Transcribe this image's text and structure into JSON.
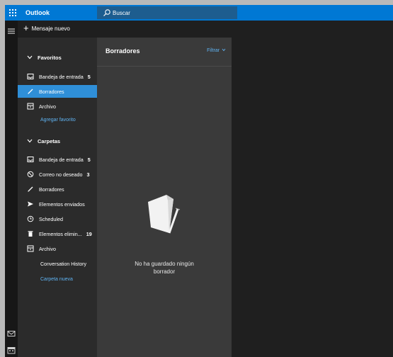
{
  "topbar": {
    "app_title": "Outlook",
    "search_placeholder": "Buscar",
    "accent_color": "#0078d4"
  },
  "toolbar": {
    "new_message_label": "Mensaje nuevo"
  },
  "favorites": {
    "header": "Favoritos",
    "items": [
      {
        "label": "Bandeja de entrada",
        "count": "5",
        "icon": "inbox-icon",
        "selected": false
      },
      {
        "label": "Borradores",
        "count": "",
        "icon": "pencil-icon",
        "selected": true
      },
      {
        "label": "Archivo",
        "count": "",
        "icon": "archive-icon",
        "selected": false
      }
    ],
    "add_favorite_label": "Agregar favorito"
  },
  "folders": {
    "header": "Carpetas",
    "items": [
      {
        "label": "Bandeja de entrada",
        "count": "5",
        "icon": "inbox-icon"
      },
      {
        "label": "Correo no deseado",
        "count": "3",
        "icon": "blocked-icon"
      },
      {
        "label": "Borradores",
        "count": "",
        "icon": "pencil-icon"
      },
      {
        "label": "Elementos enviados",
        "count": "",
        "icon": "send-icon"
      },
      {
        "label": "Scheduled",
        "count": "",
        "icon": "clock-icon"
      },
      {
        "label": "Elementos elimin...",
        "count": "19",
        "icon": "trash-icon"
      },
      {
        "label": "Archivo",
        "count": "",
        "icon": "archive-icon"
      }
    ],
    "sub_items": [
      {
        "label": "Conversation History"
      },
      {
        "label": "Carpeta nueva"
      }
    ]
  },
  "message_list": {
    "title": "Borradores",
    "filter_label": "Filtrar",
    "empty_line1": "No ha guardado ningún",
    "empty_line2": "borrador"
  }
}
